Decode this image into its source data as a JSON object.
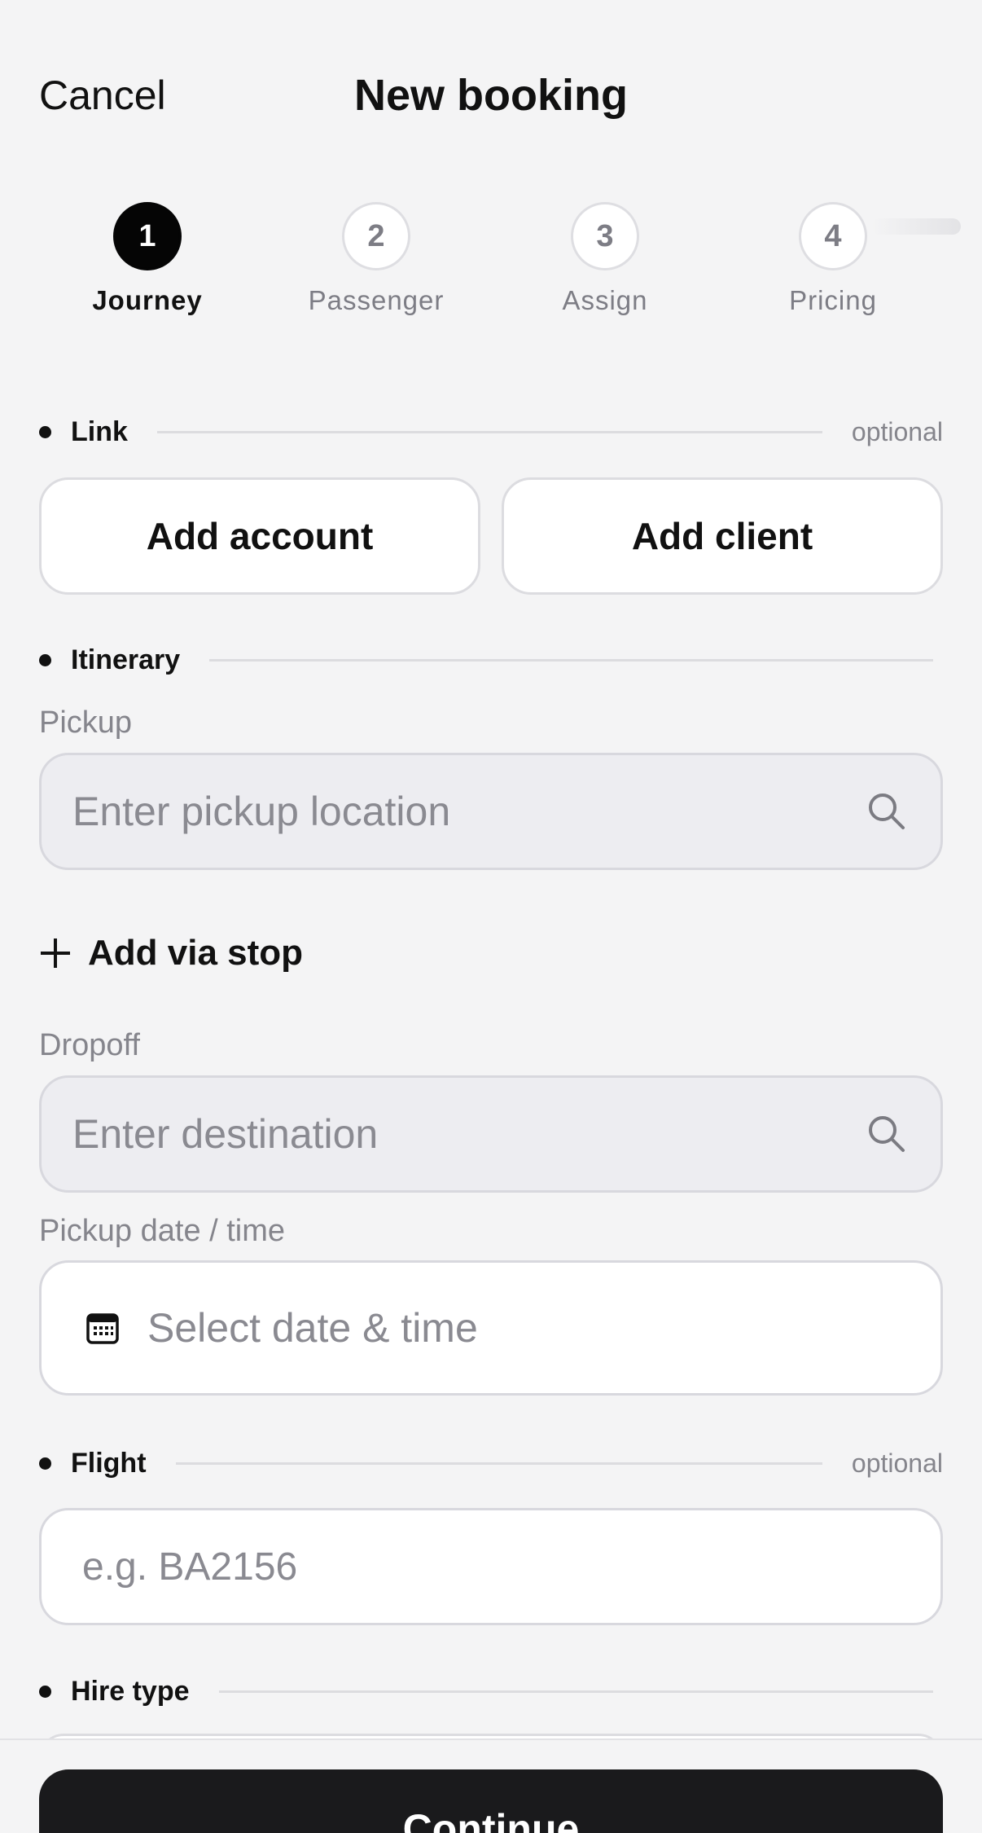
{
  "header": {
    "cancel_label": "Cancel",
    "title": "New booking"
  },
  "steps": [
    {
      "number": "1",
      "label": "Journey",
      "active": true
    },
    {
      "number": "2",
      "label": "Passenger",
      "active": false
    },
    {
      "number": "3",
      "label": "Assign",
      "active": false
    },
    {
      "number": "4",
      "label": "Pricing",
      "active": false
    }
  ],
  "link_section": {
    "title": "Link",
    "optional_label": "optional",
    "add_account_label": "Add account",
    "add_client_label": "Add client"
  },
  "itinerary_section": {
    "title": "Itinerary",
    "pickup_label": "Pickup",
    "pickup_placeholder": "Enter pickup location",
    "add_via_label": "Add via stop",
    "dropoff_label": "Dropoff",
    "dropoff_placeholder": "Enter destination",
    "datetime_label": "Pickup date / time",
    "datetime_placeholder": "Select date & time"
  },
  "flight_section": {
    "title": "Flight",
    "optional_label": "optional",
    "flight_placeholder": "e.g. BA2156"
  },
  "hire_type_section": {
    "title": "Hire type"
  },
  "footer": {
    "continue_label": "Continue"
  },
  "colors": {
    "background": "#f4f4f5",
    "active_step": "#050505",
    "primary_button": "#1a1a1c",
    "muted_text": "#85858c"
  }
}
